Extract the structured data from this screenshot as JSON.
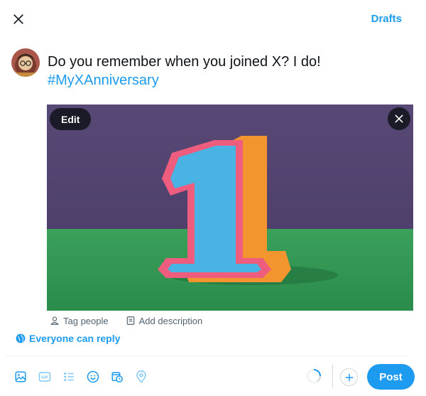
{
  "header": {
    "close_icon": "close-icon",
    "drafts_label": "Drafts"
  },
  "composer": {
    "avatar_icon": "user-avatar",
    "text": "Do you remember when you joined X? I do!",
    "hashtag": "#MyXAnniversary"
  },
  "media": {
    "edit_label": "Edit",
    "remove_icon": "close-icon",
    "tag_people_label": "Tag people",
    "add_description_label": "Add description"
  },
  "reply": {
    "label": "Everyone can reply",
    "icon": "globe-icon"
  },
  "toolbar": {
    "icons": [
      "image-icon",
      "gif-icon",
      "poll-icon",
      "emoji-icon",
      "schedule-icon",
      "location-icon"
    ],
    "post_label": "Post"
  },
  "colors": {
    "accent": "#1d9bf0",
    "text": "#0f1419",
    "secondary": "#536471",
    "border": "#eff3f4"
  }
}
